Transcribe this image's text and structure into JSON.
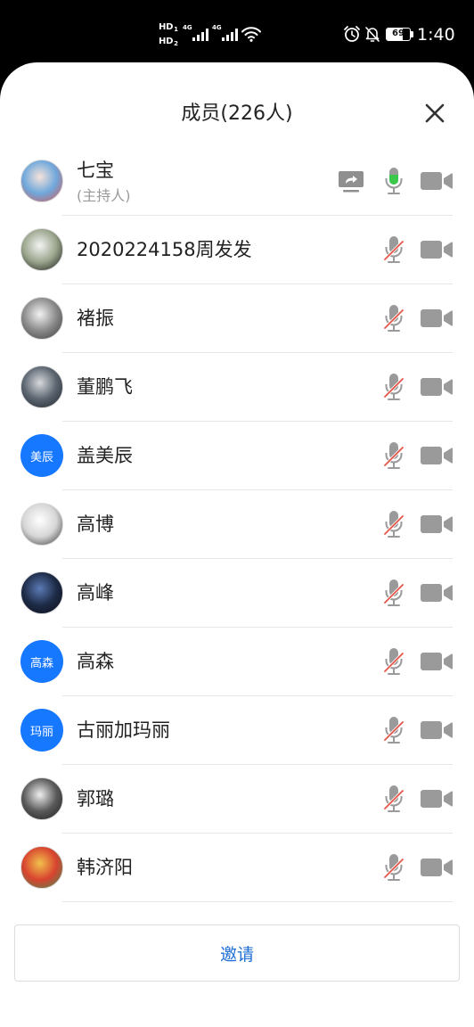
{
  "status_bar": {
    "hd_1": {
      "label": "HD",
      "sim": "1"
    },
    "hd_2": {
      "label": "HD",
      "sim": "2"
    },
    "network_1": "4G",
    "network_2": "4G",
    "battery": "69",
    "time": "1:40",
    "icons": [
      "hd-voice-icon",
      "cellular-signal-icon",
      "wifi-icon",
      "alarm-icon",
      "notifications-muted-icon",
      "battery-icon"
    ]
  },
  "header": {
    "title": "成员(226人)",
    "close_icon": "close-icon"
  },
  "members": [
    {
      "name": "七宝",
      "role": "(主持人)",
      "avatar": {
        "colors": [
          "#f6e3da",
          "#6fa8dc",
          "#d9534f"
        ]
      },
      "share_icon": "screen-share-icon",
      "mic_icon": "mic-icon",
      "video_icon": "video-camera-icon"
    },
    {
      "name": "2020224158周发发",
      "avatar": {
        "colors": [
          "#f4f4f4",
          "#9aa58c",
          "#141414"
        ]
      },
      "mic_icon": "mic-muted-icon",
      "video_icon": "video-camera-icon"
    },
    {
      "name": "褚振",
      "avatar": {
        "colors": [
          "#f2f2f2",
          "#8a8a8a",
          "#3a3a3a"
        ]
      },
      "mic_icon": "mic-muted-icon",
      "video_icon": "video-camera-icon"
    },
    {
      "name": "董鹏飞",
      "avatar": {
        "colors": [
          "#d7d9dc",
          "#5b6570",
          "#1d2127"
        ]
      },
      "mic_icon": "mic-muted-icon",
      "video_icon": "video-camera-icon"
    },
    {
      "name": "盖美辰",
      "avatar": {
        "text": "美辰",
        "color": "#1677ff"
      },
      "mic_icon": "mic-muted-icon",
      "video_icon": "video-camera-icon"
    },
    {
      "name": "高博",
      "avatar": {
        "colors": [
          "#ffffff",
          "#d6d6d6",
          "#303030"
        ]
      },
      "mic_icon": "mic-muted-icon",
      "video_icon": "video-camera-icon"
    },
    {
      "name": "高峰",
      "avatar": {
        "colors": [
          "#5a7bb5",
          "#1e2b47",
          "#0a0d16"
        ]
      },
      "mic_icon": "mic-muted-icon",
      "video_icon": "video-camera-icon"
    },
    {
      "name": "高森",
      "avatar": {
        "text": "高森",
        "color": "#1677ff"
      },
      "mic_icon": "mic-muted-icon",
      "video_icon": "video-camera-icon"
    },
    {
      "name": "古丽加玛丽",
      "avatar": {
        "text": "玛丽",
        "color": "#1677ff"
      },
      "mic_icon": "mic-muted-icon",
      "video_icon": "video-camera-icon"
    },
    {
      "name": "郭璐",
      "avatar": {
        "colors": [
          "#efefef",
          "#5a5a5a",
          "#1c1c1c"
        ]
      },
      "mic_icon": "mic-muted-icon",
      "video_icon": "video-camera-icon"
    },
    {
      "name": "韩济阳",
      "avatar": {
        "colors": [
          "#f1c14b",
          "#d8432f",
          "#3f8f52"
        ]
      },
      "mic_icon": "mic-muted-icon",
      "video_icon": "video-camera-icon"
    }
  ],
  "invite": {
    "label": "邀请"
  },
  "colors": {
    "backdrop": "#000000",
    "panel": "#ffffff",
    "accent": "#1f6fd6",
    "icon_gray": "#9a9a9a",
    "mic_active": "#3cc84b",
    "mute_slash": "#e5554a",
    "divider": "#e6e6e6"
  }
}
